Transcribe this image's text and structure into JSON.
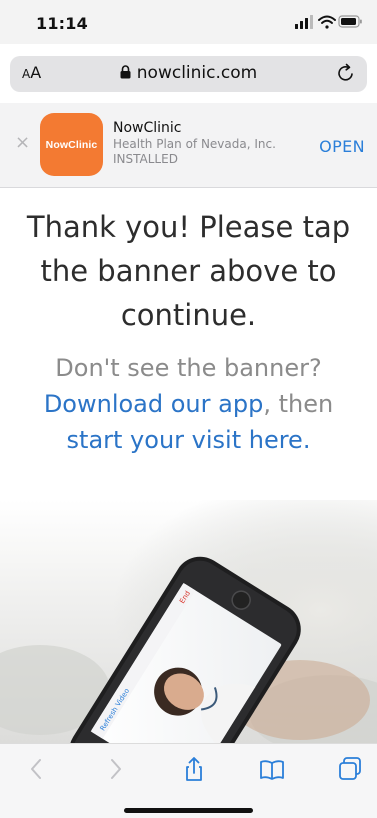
{
  "status_bar": {
    "time": "11:14",
    "icons": [
      "signal-icon",
      "wifi-icon",
      "battery-icon"
    ]
  },
  "address_bar": {
    "text_size_label_small": "A",
    "text_size_label_large": "A",
    "url": "nowclinic.com",
    "icons": [
      "lock-icon",
      "reload-icon"
    ]
  },
  "app_banner": {
    "close_glyph": "×",
    "icon_text": "NowClinic",
    "app_name": "NowClinic",
    "publisher": "Health Plan of Nevada, Inc.",
    "status": "INSTALLED",
    "open_label": "OPEN"
  },
  "content": {
    "headline": "Thank you! Please tap the banner above to continue.",
    "sub_text": "Don't see the banner?",
    "download_link": "Download our app",
    "separator": ", then",
    "start_visit_link": "start your visit here."
  },
  "toolbar": {
    "icons": [
      "back-icon",
      "forward-icon",
      "share-icon",
      "bookmarks-icon",
      "tabs-icon"
    ]
  },
  "colors": {
    "accent_blue": "#2b7fd9",
    "link_blue": "#2b74c7",
    "app_icon_orange": "#f37a32",
    "headline_text": "#2d2d2d",
    "muted_text": "#8b8b8b"
  }
}
